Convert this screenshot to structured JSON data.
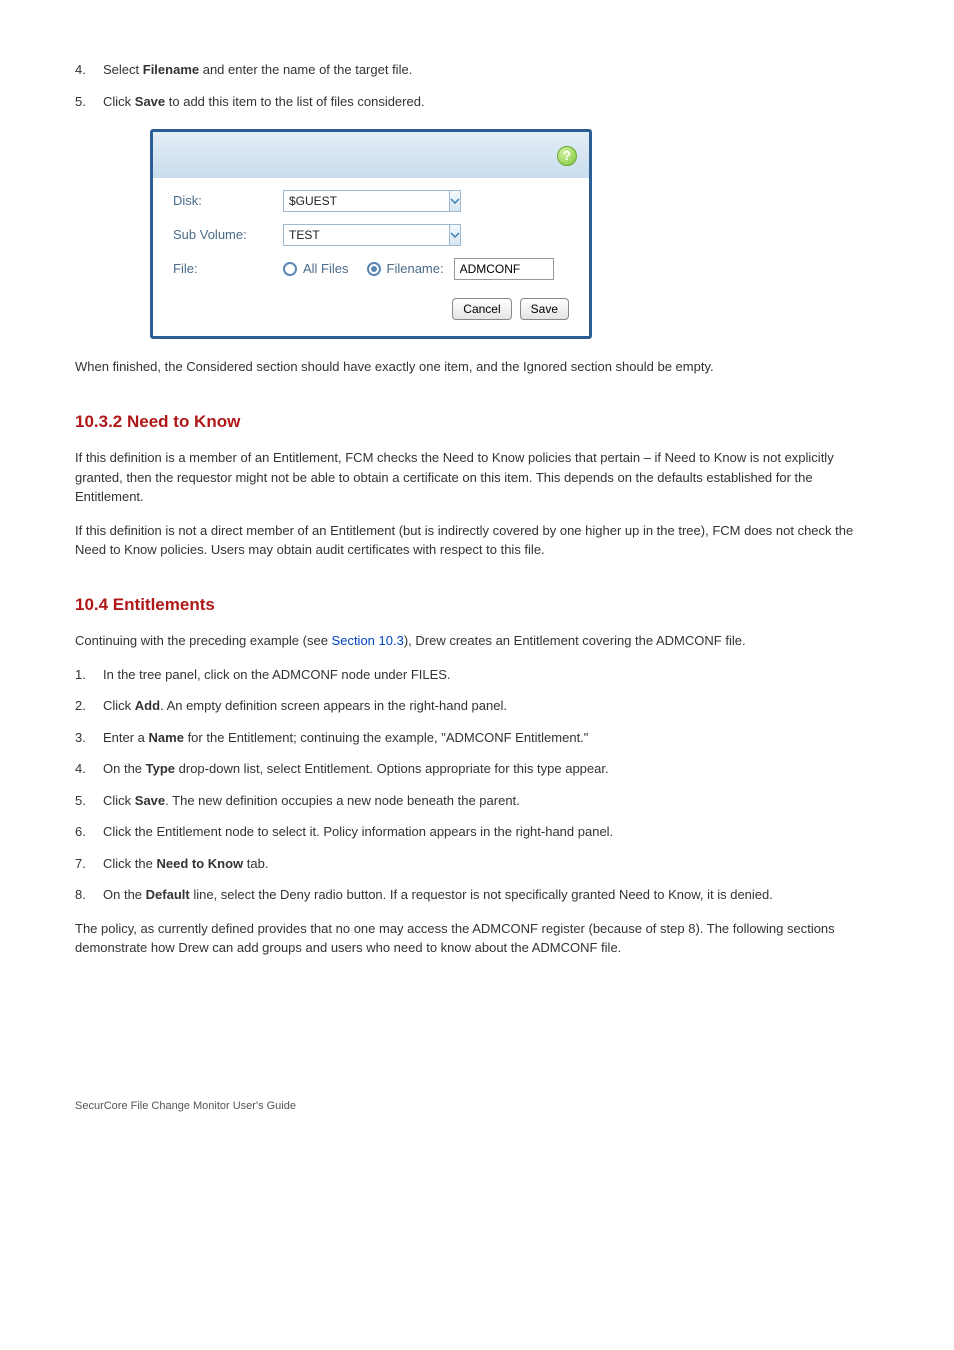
{
  "steps_top": [
    {
      "num": "4.",
      "text_before": "Select ",
      "bold": "Filename",
      "text_after": " and enter the name of the target file."
    },
    {
      "num": "5.",
      "text_before": "Click ",
      "bold": "Save",
      "text_after": " to add this item to the list of files considered."
    }
  ],
  "dialog": {
    "help_glyph": "?",
    "labels": {
      "disk": "Disk:",
      "sub_volume": "Sub Volume:",
      "file": "File:"
    },
    "disk_value": "$GUEST",
    "sub_volume_value": "TEST",
    "radios": {
      "all_files": "All Files",
      "filename": "Filename:"
    },
    "filename_value": "ADMCONF",
    "buttons": {
      "cancel": "Cancel",
      "save": "Save"
    }
  },
  "para_after_dialog": "When finished, the Considered section should have exactly one item, and the Ignored section should be empty.",
  "section_title": "10.3.2 Need to Know",
  "paras": [
    "If this definition is a member of an Entitlement, FCM checks the Need to Know policies that pertain – if Need to Know is not explicitly granted, then the requestor might not be able to obtain a certificate on this item. This depends on the defaults established for the Entitlement.",
    "If this definition is not a direct member of an Entitlement (but is indirectly covered by one higher up in the tree), FCM does not check the Need to Know policies. Users may obtain audit certificates with respect to this file."
  ],
  "section10_4": {
    "title": "10.4 Entitlements",
    "intro_before": "Continuing with the preceding example (see ",
    "intro_link": "Section 10.3",
    "intro_after": "), Drew creates an Entitlement covering the ADMCONF file.",
    "steps": [
      {
        "num": "1.",
        "text": "In the tree panel, click on the ADMCONF node under FILES."
      },
      {
        "num": "2.",
        "before": "Click ",
        "bold": "Add",
        "after": ". An empty definition screen appears in the right-hand panel."
      },
      {
        "num": "3.",
        "before": "Enter a ",
        "bold": "Name",
        "after": " for the Entitlement; continuing the example, \"ADMCONF Entitlement.\""
      },
      {
        "num": "4.",
        "before": "On the ",
        "bold": "Type",
        "after": " drop-down list, select Entitlement. Options appropriate for this type appear."
      },
      {
        "num": "5.",
        "before": "Click ",
        "bold": "Save",
        "after": ". The new definition occupies a new node beneath the parent."
      },
      {
        "num": "6.",
        "text": "Click the Entitlement node to select it. Policy information appears in the right-hand panel."
      },
      {
        "num": "7.",
        "before": "Click the ",
        "bold": "Need to Know",
        "after": " tab."
      },
      {
        "num": "8.",
        "before": "On the ",
        "bold": "Default",
        "after": " line, select the Deny radio button. If a requestor is not specifically granted Need to Know, it is denied."
      }
    ],
    "closing": "The policy, as currently defined provides that no one may access the ADMCONF register (because of step 8). The following sections demonstrate how Drew can add groups and users who need to know about the ADMCONF file."
  },
  "footer": "SecurCore File Change Monitor User's Guide"
}
